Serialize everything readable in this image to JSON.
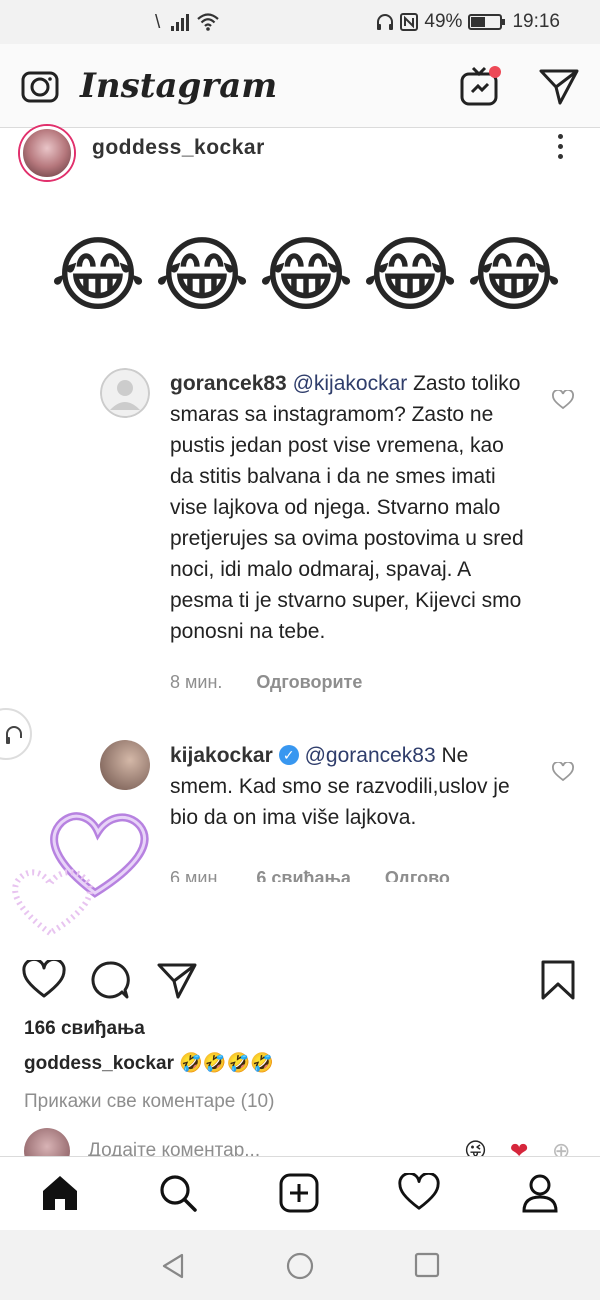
{
  "status_bar": {
    "left_indicator": "\\",
    "battery_percent": "49%",
    "time": "19:16"
  },
  "app": {
    "name": "Instagram",
    "icons": [
      "camera-icon",
      "igtv-icon",
      "direct-send-icon"
    ],
    "notification_dot_color": "#ed4956"
  },
  "post": {
    "username": "goddess_kockar",
    "image": {
      "emojis": [
        "😂",
        "😂",
        "😂",
        "😂",
        "😂"
      ],
      "comments": [
        {
          "username": "gorancek83",
          "mention": "@kijakockar",
          "text": "Zasto toliko smaras sa instagramom? Zasto ne pustis jedan post vise vremena, kao da stitis balvana i da ne smes imati vise lajkova od njega. Stvarno malo pretjerujes sa ovima postovima u sred noci, idi malo odmaraj, spavaj. A pesma ti je stvarno super, Kijevci smo ponosni na tebe.",
          "time": "8 мин.",
          "reply": "Одговорите"
        },
        {
          "username": "kijakockar",
          "verified": true,
          "mention": "@gorancek83",
          "text": "Ne smem. Kad smo se razvodili,uslov je bio da on ima više lajkova.",
          "time": "6 мин.",
          "likes": "6 свиђања",
          "reply": "Одгово"
        }
      ]
    },
    "likes_text": "166 свиђања",
    "caption_username": "goddess_kockar",
    "caption_emojis": "🤣🤣🤣🤣",
    "view_all_comments": "Прикажи све коментаре (10)",
    "add_comment_placeholder": "Додајте коментар...",
    "quick_emojis": [
      "😜",
      "❤",
      "⊕"
    ]
  },
  "bottom_nav": [
    "home-icon",
    "search-icon",
    "new-post-icon",
    "activity-heart-icon",
    "profile-icon"
  ],
  "system_nav": [
    "back-icon",
    "home-circle-icon",
    "recents-icon"
  ]
}
